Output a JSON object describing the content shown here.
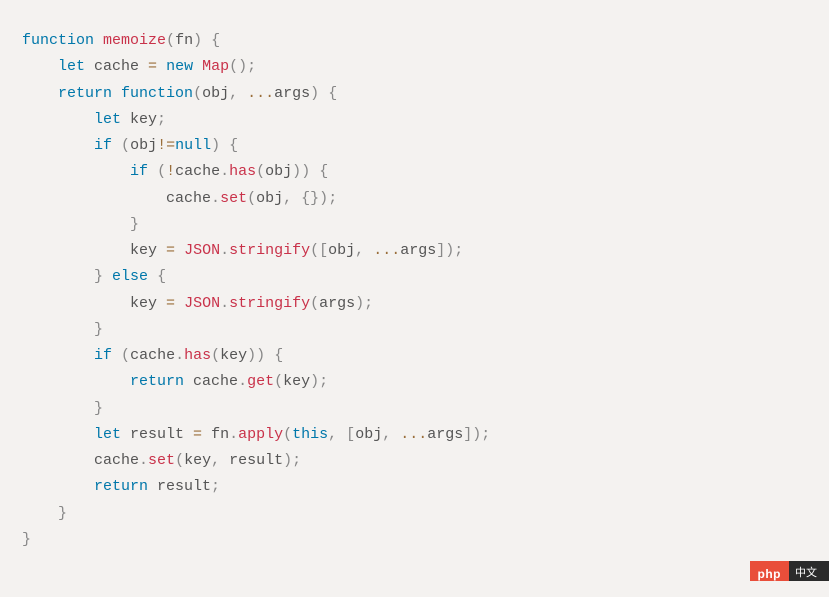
{
  "code": {
    "tokens": [
      {
        "cls": "kw",
        "t": "function"
      },
      {
        "cls": "",
        "t": " "
      },
      {
        "cls": "fn",
        "t": "memoize"
      },
      {
        "cls": "punc",
        "t": "("
      },
      {
        "cls": "param",
        "t": "fn"
      },
      {
        "cls": "punc",
        "t": ")"
      },
      {
        "cls": "",
        "t": " "
      },
      {
        "cls": "punc",
        "t": "{"
      },
      {
        "cls": "",
        "t": "\n    "
      },
      {
        "cls": "kw",
        "t": "let"
      },
      {
        "cls": "",
        "t": " cache "
      },
      {
        "cls": "op",
        "t": "="
      },
      {
        "cls": "",
        "t": " "
      },
      {
        "cls": "kw",
        "t": "new"
      },
      {
        "cls": "",
        "t": " "
      },
      {
        "cls": "cls",
        "t": "Map"
      },
      {
        "cls": "punc",
        "t": "("
      },
      {
        "cls": "punc",
        "t": ")"
      },
      {
        "cls": "punc",
        "t": ";"
      },
      {
        "cls": "",
        "t": "\n    "
      },
      {
        "cls": "kw",
        "t": "return"
      },
      {
        "cls": "",
        "t": " "
      },
      {
        "cls": "kw",
        "t": "function"
      },
      {
        "cls": "punc",
        "t": "("
      },
      {
        "cls": "param",
        "t": "obj"
      },
      {
        "cls": "punc",
        "t": ","
      },
      {
        "cls": "",
        "t": " "
      },
      {
        "cls": "op",
        "t": "..."
      },
      {
        "cls": "param",
        "t": "args"
      },
      {
        "cls": "punc",
        "t": ")"
      },
      {
        "cls": "",
        "t": " "
      },
      {
        "cls": "punc",
        "t": "{"
      },
      {
        "cls": "",
        "t": "\n        "
      },
      {
        "cls": "kw",
        "t": "let"
      },
      {
        "cls": "",
        "t": " key"
      },
      {
        "cls": "punc",
        "t": ";"
      },
      {
        "cls": "",
        "t": "\n        "
      },
      {
        "cls": "kw",
        "t": "if"
      },
      {
        "cls": "",
        "t": " "
      },
      {
        "cls": "punc",
        "t": "("
      },
      {
        "cls": "",
        "t": "obj"
      },
      {
        "cls": "op",
        "t": "!="
      },
      {
        "cls": "kw",
        "t": "null"
      },
      {
        "cls": "punc",
        "t": ")"
      },
      {
        "cls": "",
        "t": " "
      },
      {
        "cls": "punc",
        "t": "{"
      },
      {
        "cls": "",
        "t": "\n            "
      },
      {
        "cls": "kw",
        "t": "if"
      },
      {
        "cls": "",
        "t": " "
      },
      {
        "cls": "punc",
        "t": "("
      },
      {
        "cls": "op",
        "t": "!"
      },
      {
        "cls": "",
        "t": "cache"
      },
      {
        "cls": "punc",
        "t": "."
      },
      {
        "cls": "fn",
        "t": "has"
      },
      {
        "cls": "punc",
        "t": "("
      },
      {
        "cls": "",
        "t": "obj"
      },
      {
        "cls": "punc",
        "t": ")"
      },
      {
        "cls": "punc",
        "t": ")"
      },
      {
        "cls": "",
        "t": " "
      },
      {
        "cls": "punc",
        "t": "{"
      },
      {
        "cls": "",
        "t": "\n                "
      },
      {
        "cls": "",
        "t": "cache"
      },
      {
        "cls": "punc",
        "t": "."
      },
      {
        "cls": "fn",
        "t": "set"
      },
      {
        "cls": "punc",
        "t": "("
      },
      {
        "cls": "",
        "t": "obj"
      },
      {
        "cls": "punc",
        "t": ","
      },
      {
        "cls": "",
        "t": " "
      },
      {
        "cls": "punc",
        "t": "{"
      },
      {
        "cls": "punc",
        "t": "}"
      },
      {
        "cls": "punc",
        "t": ")"
      },
      {
        "cls": "punc",
        "t": ";"
      },
      {
        "cls": "",
        "t": "\n            "
      },
      {
        "cls": "punc",
        "t": "}"
      },
      {
        "cls": "",
        "t": "\n            "
      },
      {
        "cls": "",
        "t": "key "
      },
      {
        "cls": "op",
        "t": "="
      },
      {
        "cls": "",
        "t": " "
      },
      {
        "cls": "cls",
        "t": "JSON"
      },
      {
        "cls": "punc",
        "t": "."
      },
      {
        "cls": "fn",
        "t": "stringify"
      },
      {
        "cls": "punc",
        "t": "("
      },
      {
        "cls": "punc",
        "t": "["
      },
      {
        "cls": "",
        "t": "obj"
      },
      {
        "cls": "punc",
        "t": ","
      },
      {
        "cls": "",
        "t": " "
      },
      {
        "cls": "op",
        "t": "..."
      },
      {
        "cls": "",
        "t": "args"
      },
      {
        "cls": "punc",
        "t": "]"
      },
      {
        "cls": "punc",
        "t": ")"
      },
      {
        "cls": "punc",
        "t": ";"
      },
      {
        "cls": "",
        "t": "\n        "
      },
      {
        "cls": "punc",
        "t": "}"
      },
      {
        "cls": "",
        "t": " "
      },
      {
        "cls": "kw",
        "t": "else"
      },
      {
        "cls": "",
        "t": " "
      },
      {
        "cls": "punc",
        "t": "{"
      },
      {
        "cls": "",
        "t": "\n            "
      },
      {
        "cls": "",
        "t": "key "
      },
      {
        "cls": "op",
        "t": "="
      },
      {
        "cls": "",
        "t": " "
      },
      {
        "cls": "cls",
        "t": "JSON"
      },
      {
        "cls": "punc",
        "t": "."
      },
      {
        "cls": "fn",
        "t": "stringify"
      },
      {
        "cls": "punc",
        "t": "("
      },
      {
        "cls": "",
        "t": "args"
      },
      {
        "cls": "punc",
        "t": ")"
      },
      {
        "cls": "punc",
        "t": ";"
      },
      {
        "cls": "",
        "t": "\n        "
      },
      {
        "cls": "punc",
        "t": "}"
      },
      {
        "cls": "",
        "t": "\n        "
      },
      {
        "cls": "kw",
        "t": "if"
      },
      {
        "cls": "",
        "t": " "
      },
      {
        "cls": "punc",
        "t": "("
      },
      {
        "cls": "",
        "t": "cache"
      },
      {
        "cls": "punc",
        "t": "."
      },
      {
        "cls": "fn",
        "t": "has"
      },
      {
        "cls": "punc",
        "t": "("
      },
      {
        "cls": "",
        "t": "key"
      },
      {
        "cls": "punc",
        "t": ")"
      },
      {
        "cls": "punc",
        "t": ")"
      },
      {
        "cls": "",
        "t": " "
      },
      {
        "cls": "punc",
        "t": "{"
      },
      {
        "cls": "",
        "t": "\n            "
      },
      {
        "cls": "kw",
        "t": "return"
      },
      {
        "cls": "",
        "t": " cache"
      },
      {
        "cls": "punc",
        "t": "."
      },
      {
        "cls": "fn",
        "t": "get"
      },
      {
        "cls": "punc",
        "t": "("
      },
      {
        "cls": "",
        "t": "key"
      },
      {
        "cls": "punc",
        "t": ")"
      },
      {
        "cls": "punc",
        "t": ";"
      },
      {
        "cls": "",
        "t": "\n        "
      },
      {
        "cls": "punc",
        "t": "}"
      },
      {
        "cls": "",
        "t": "\n        "
      },
      {
        "cls": "kw",
        "t": "let"
      },
      {
        "cls": "",
        "t": " result "
      },
      {
        "cls": "op",
        "t": "="
      },
      {
        "cls": "",
        "t": " fn"
      },
      {
        "cls": "punc",
        "t": "."
      },
      {
        "cls": "fn",
        "t": "apply"
      },
      {
        "cls": "punc",
        "t": "("
      },
      {
        "cls": "kw",
        "t": "this"
      },
      {
        "cls": "punc",
        "t": ","
      },
      {
        "cls": "",
        "t": " "
      },
      {
        "cls": "punc",
        "t": "["
      },
      {
        "cls": "",
        "t": "obj"
      },
      {
        "cls": "punc",
        "t": ","
      },
      {
        "cls": "",
        "t": " "
      },
      {
        "cls": "op",
        "t": "..."
      },
      {
        "cls": "",
        "t": "args"
      },
      {
        "cls": "punc",
        "t": "]"
      },
      {
        "cls": "punc",
        "t": ")"
      },
      {
        "cls": "punc",
        "t": ";"
      },
      {
        "cls": "",
        "t": "\n        "
      },
      {
        "cls": "",
        "t": "cache"
      },
      {
        "cls": "punc",
        "t": "."
      },
      {
        "cls": "fn",
        "t": "set"
      },
      {
        "cls": "punc",
        "t": "("
      },
      {
        "cls": "",
        "t": "key"
      },
      {
        "cls": "punc",
        "t": ","
      },
      {
        "cls": "",
        "t": " result"
      },
      {
        "cls": "punc",
        "t": ")"
      },
      {
        "cls": "punc",
        "t": ";"
      },
      {
        "cls": "",
        "t": "\n        "
      },
      {
        "cls": "kw",
        "t": "return"
      },
      {
        "cls": "",
        "t": " result"
      },
      {
        "cls": "punc",
        "t": ";"
      },
      {
        "cls": "",
        "t": "\n    "
      },
      {
        "cls": "punc",
        "t": "}"
      },
      {
        "cls": "",
        "t": "\n"
      },
      {
        "cls": "punc",
        "t": "}"
      }
    ]
  },
  "watermark": {
    "php": "php",
    "cn": "中文"
  }
}
